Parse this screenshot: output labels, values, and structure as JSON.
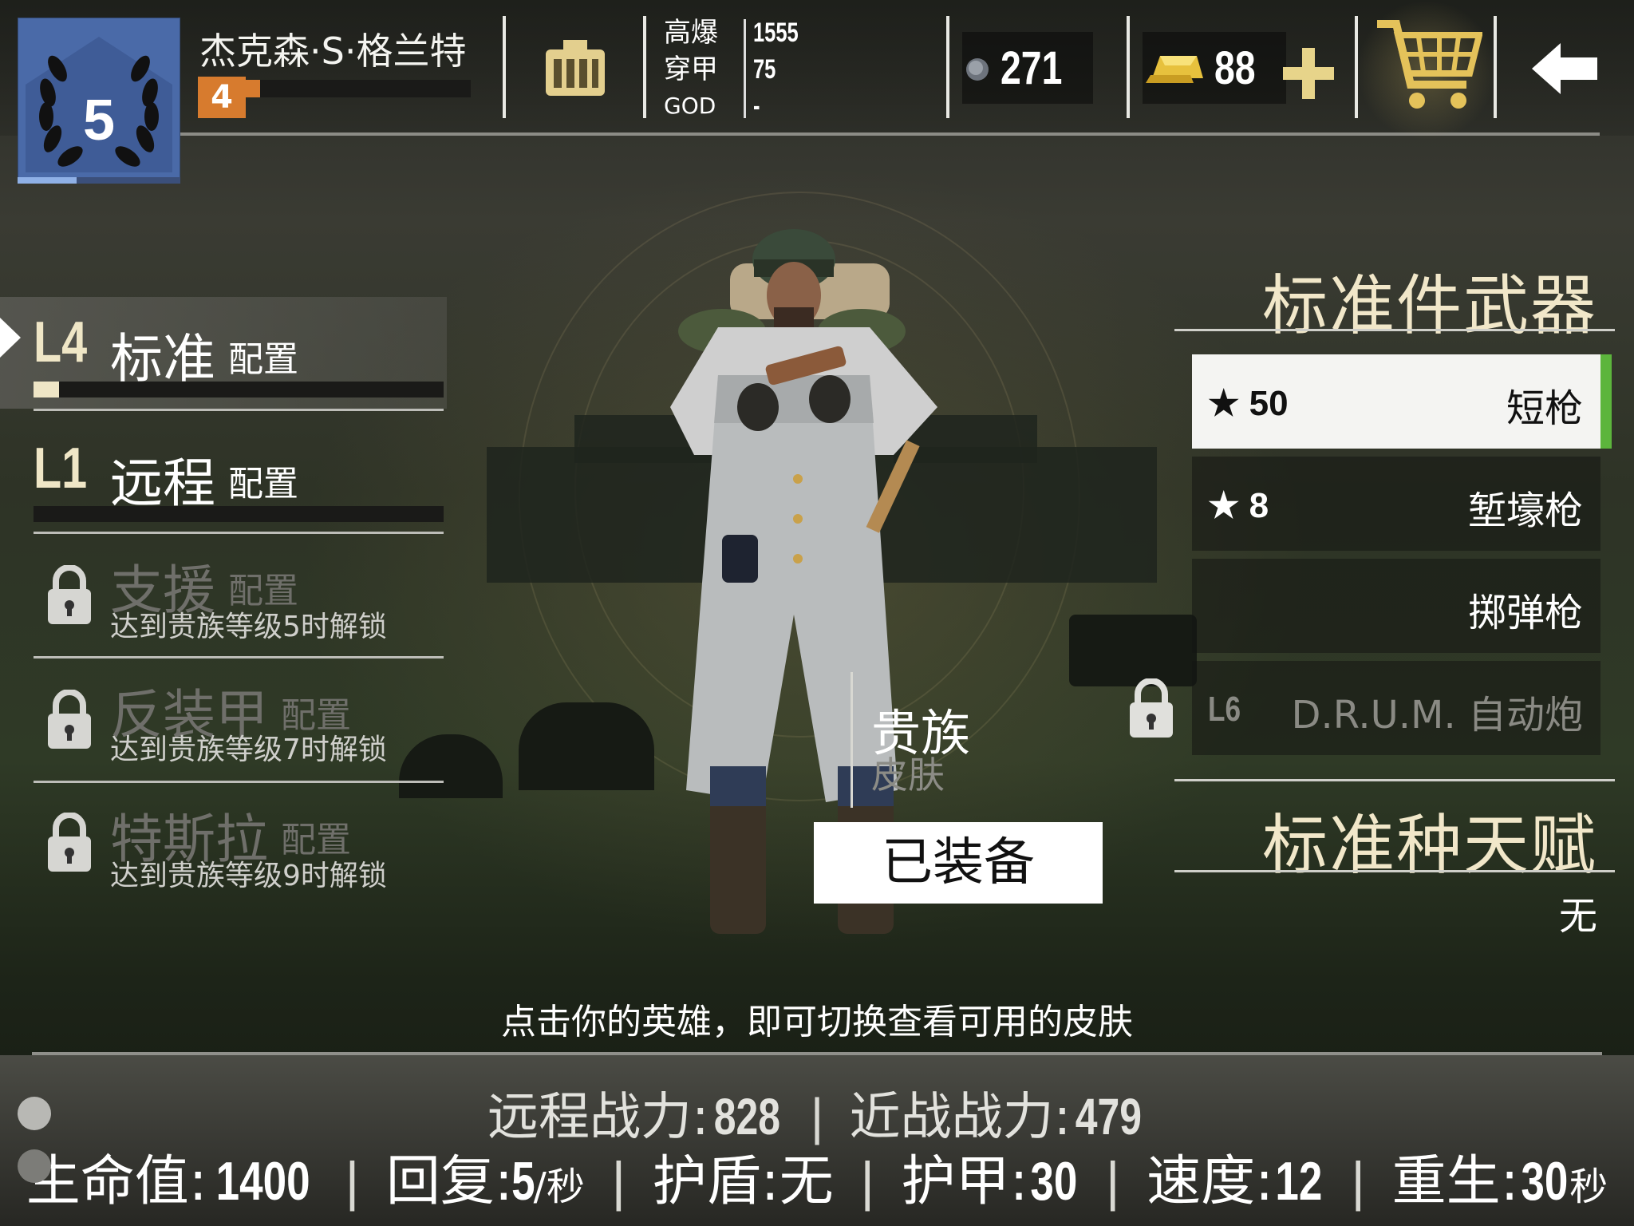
{
  "header": {
    "rank_level": "5",
    "player_name": "杰克森·S·格兰特",
    "player_level": "4",
    "stats": [
      {
        "label": "高爆",
        "value": "1555"
      },
      {
        "label": "穿甲",
        "value": "75"
      },
      {
        "label": "GOD",
        "value": "-"
      }
    ],
    "silver": "271",
    "gold": "88",
    "icons": [
      "laurel-icon",
      "armory-icon",
      "silver-coin-icon",
      "gold-bar-icon",
      "plus-icon",
      "cart-icon",
      "back-arrow-icon"
    ]
  },
  "loadouts": [
    {
      "code": "L4",
      "name": "标准",
      "suffix": "配置",
      "selected": true,
      "progress": 0.05
    },
    {
      "code": "L1",
      "name": "远程",
      "suffix": "配置",
      "selected": false,
      "progress": 0
    },
    {
      "name": "支援",
      "suffix": "配置",
      "locked": true,
      "unlock_text": "达到贵族等级5时解锁"
    },
    {
      "name": "反装甲",
      "suffix": "配置",
      "locked": true,
      "unlock_text": "达到贵族等级7时解锁"
    },
    {
      "name": "特斯拉",
      "suffix": "配置",
      "locked": true,
      "unlock_text": "达到贵族等级9时解锁"
    }
  ],
  "weapons": {
    "title": "标准件武器",
    "items": [
      {
        "stars": "★ 50",
        "name": "短枪",
        "selected": true
      },
      {
        "stars": "★ 8",
        "name": "堑壕枪"
      },
      {
        "stars": "",
        "name": "掷弹枪"
      },
      {
        "level": "L6",
        "name": "D.R.U.M. 自动炮",
        "locked": true
      }
    ]
  },
  "talent": {
    "title": "标准种天赋",
    "value": "无"
  },
  "skin": {
    "title": "贵族",
    "subtitle": "皮肤",
    "button": "已装备"
  },
  "hint": "点击你的英雄，即可切换查看可用的皮肤",
  "bottom_stats": {
    "ranged_label": "远程战力:",
    "ranged_value": "828",
    "melee_label": "近战战力:",
    "melee_value": "479",
    "hp_label": "生命值:",
    "hp_value": "1400",
    "regen_label": "回复:",
    "regen_value": "5",
    "regen_unit": "/秒",
    "shield_label": "护盾:",
    "shield_value": "无",
    "armor_label": "护甲:",
    "armor_value": "30",
    "speed_label": "速度:",
    "speed_value": "12",
    "respawn_label": "重生:",
    "respawn_value": "30",
    "respawn_unit": "秒",
    "separator": "|"
  },
  "colors": {
    "rank_blue": "#4a6aa8",
    "level_orange": "#d77b2e",
    "gold_text": "#f1e7c9",
    "selected_green": "#5cb53c"
  }
}
